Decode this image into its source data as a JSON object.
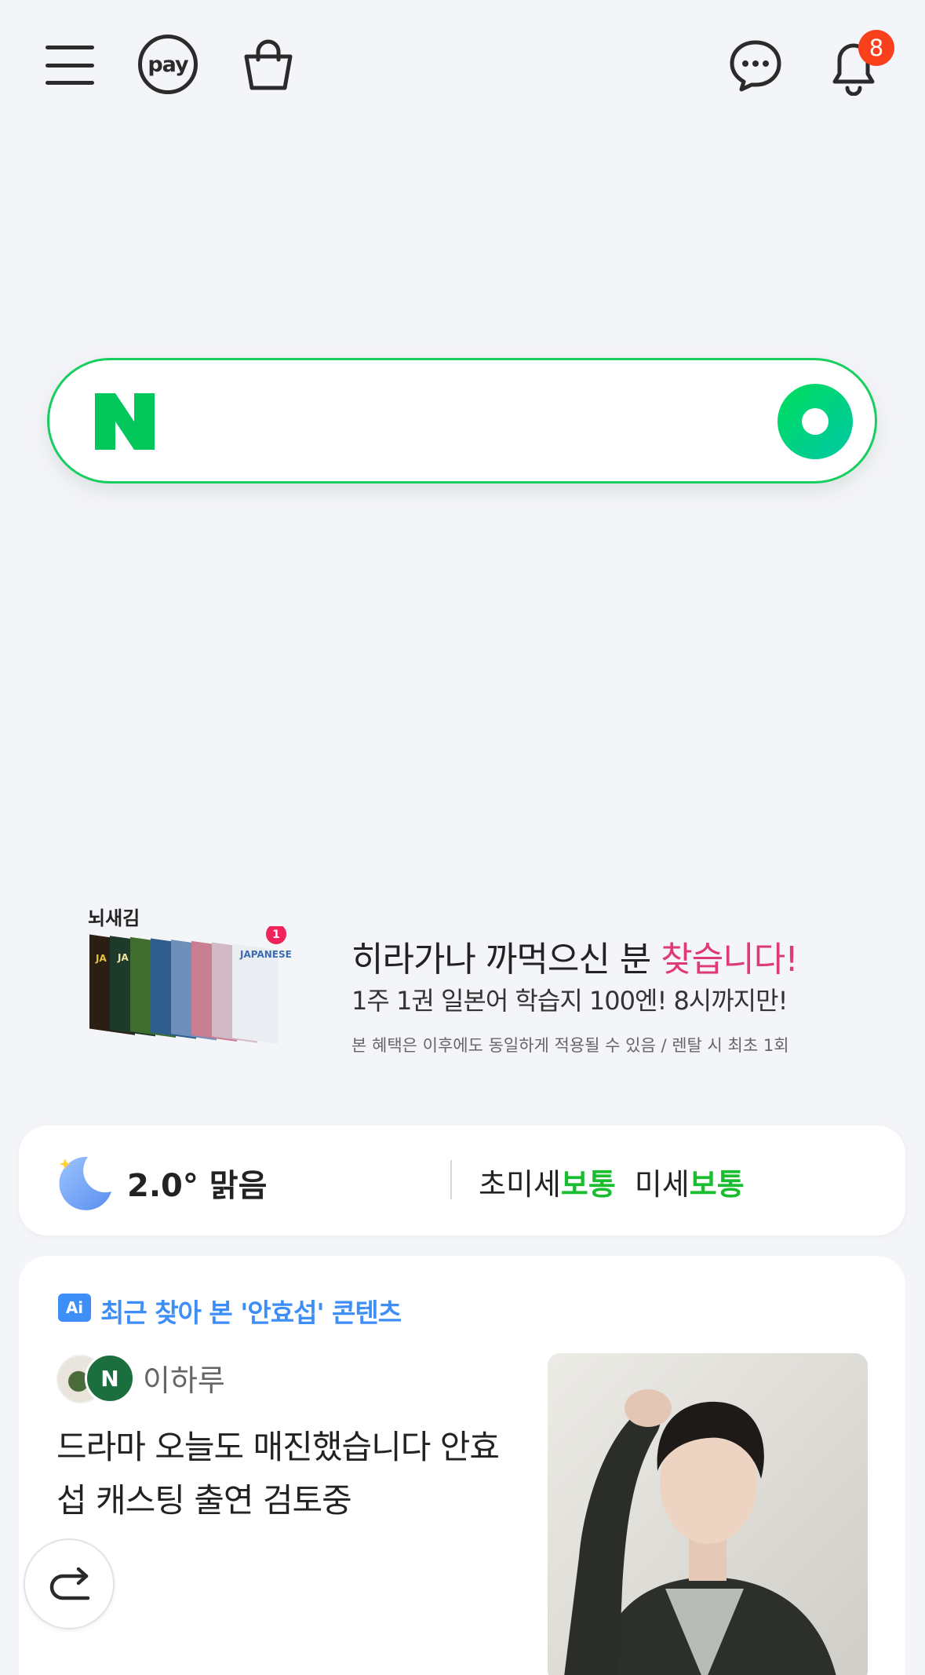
{
  "topbar": {
    "pay_label": "pay",
    "notification_count": "8"
  },
  "search": {
    "placeholder": ""
  },
  "ad": {
    "brand": "뇌새김",
    "book_badge": "1",
    "headline_prefix": "히라가나 까먹으신 분 ",
    "headline_highlight": "찾습니다!",
    "subline": "1주 1권 일본어 학습지 100엔! 8시까지만!",
    "note": "본 혜택은 이후에도 동일하게 적용될 수 있음 / 렌탈 시 최초 1회"
  },
  "weather": {
    "temp_condition": "2.0° 맑음",
    "fine_dust_label": "초미세",
    "fine_dust_value": "보통",
    "dust_label": "미세",
    "dust_value": "보통"
  },
  "content_card": {
    "ai_badge": "Ai",
    "section_title": "최근 찾아 본 '안효섭' 콘텐츠",
    "author": "이하루",
    "headline": "드라마 오늘도 매진했습니다 안효섭 캐스팅 출연 검토중"
  },
  "colors": {
    "naver_green": "#03c75a",
    "accent_blue": "#3e8ef7",
    "badge_red": "#fa3f1d",
    "good_green": "#19bd2f",
    "ad_pink": "#e0397a"
  }
}
